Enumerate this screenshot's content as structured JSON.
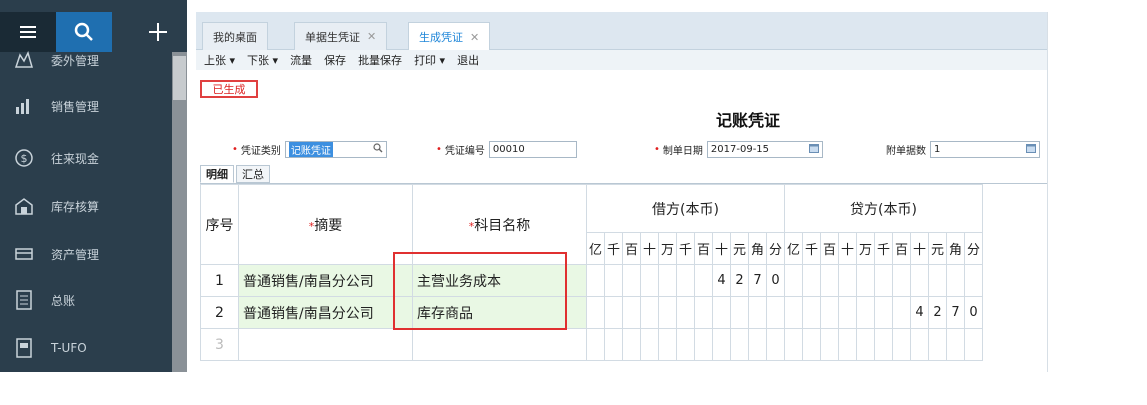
{
  "sidebar": {
    "items": [
      {
        "label": "委外管理",
        "icon": "outsourcing-icon"
      },
      {
        "label": "销售管理",
        "icon": "sales-chart-icon"
      },
      {
        "label": "往来现金",
        "icon": "currency-icon"
      },
      {
        "label": "库存核算",
        "icon": "warehouse-icon"
      },
      {
        "label": "资产管理",
        "icon": "asset-icon"
      },
      {
        "label": "总账",
        "icon": "ledger-icon"
      },
      {
        "label": "T-UFO",
        "icon": "report-icon"
      }
    ]
  },
  "tabs": [
    {
      "label": "我的桌面",
      "closable": false
    },
    {
      "label": "单据生凭证",
      "closable": true
    },
    {
      "label": "生成凭证",
      "closable": true,
      "active": true
    }
  ],
  "toolbar": [
    "上张 ▾",
    "下张 ▾",
    "流量",
    "保存",
    "批量保存",
    "打印 ▾",
    "退出"
  ],
  "status": "已生成",
  "voucher": {
    "title": "记账凭证",
    "type_label": "凭证类别",
    "type_value": "记账凭证",
    "number_label": "凭证编号",
    "number_value": "00010",
    "date_label": "制单日期",
    "date_value": "2017-09-15",
    "attach_label": "附单据数",
    "attach_value": "1"
  },
  "subtabs": [
    "明细",
    "汇总"
  ],
  "grid": {
    "headers": {
      "seq": "序号",
      "summary": "摘要",
      "account": "科目名称",
      "debit": "借方(本币)",
      "credit": "贷方(本币)"
    },
    "digit_headers": [
      "亿",
      "千",
      "百",
      "十",
      "万",
      "千",
      "百",
      "十",
      "元",
      "角",
      "分"
    ],
    "rows": [
      {
        "seq": "1",
        "summary": "普通销售/南昌分公司",
        "account": "主营业务成本",
        "debit": "4270",
        "credit": ""
      },
      {
        "seq": "2",
        "summary": "普通销售/南昌分公司",
        "account": "库存商品",
        "debit": "",
        "credit": "4270"
      },
      {
        "seq": "3",
        "summary": "",
        "account": "",
        "debit": "",
        "credit": ""
      }
    ]
  }
}
